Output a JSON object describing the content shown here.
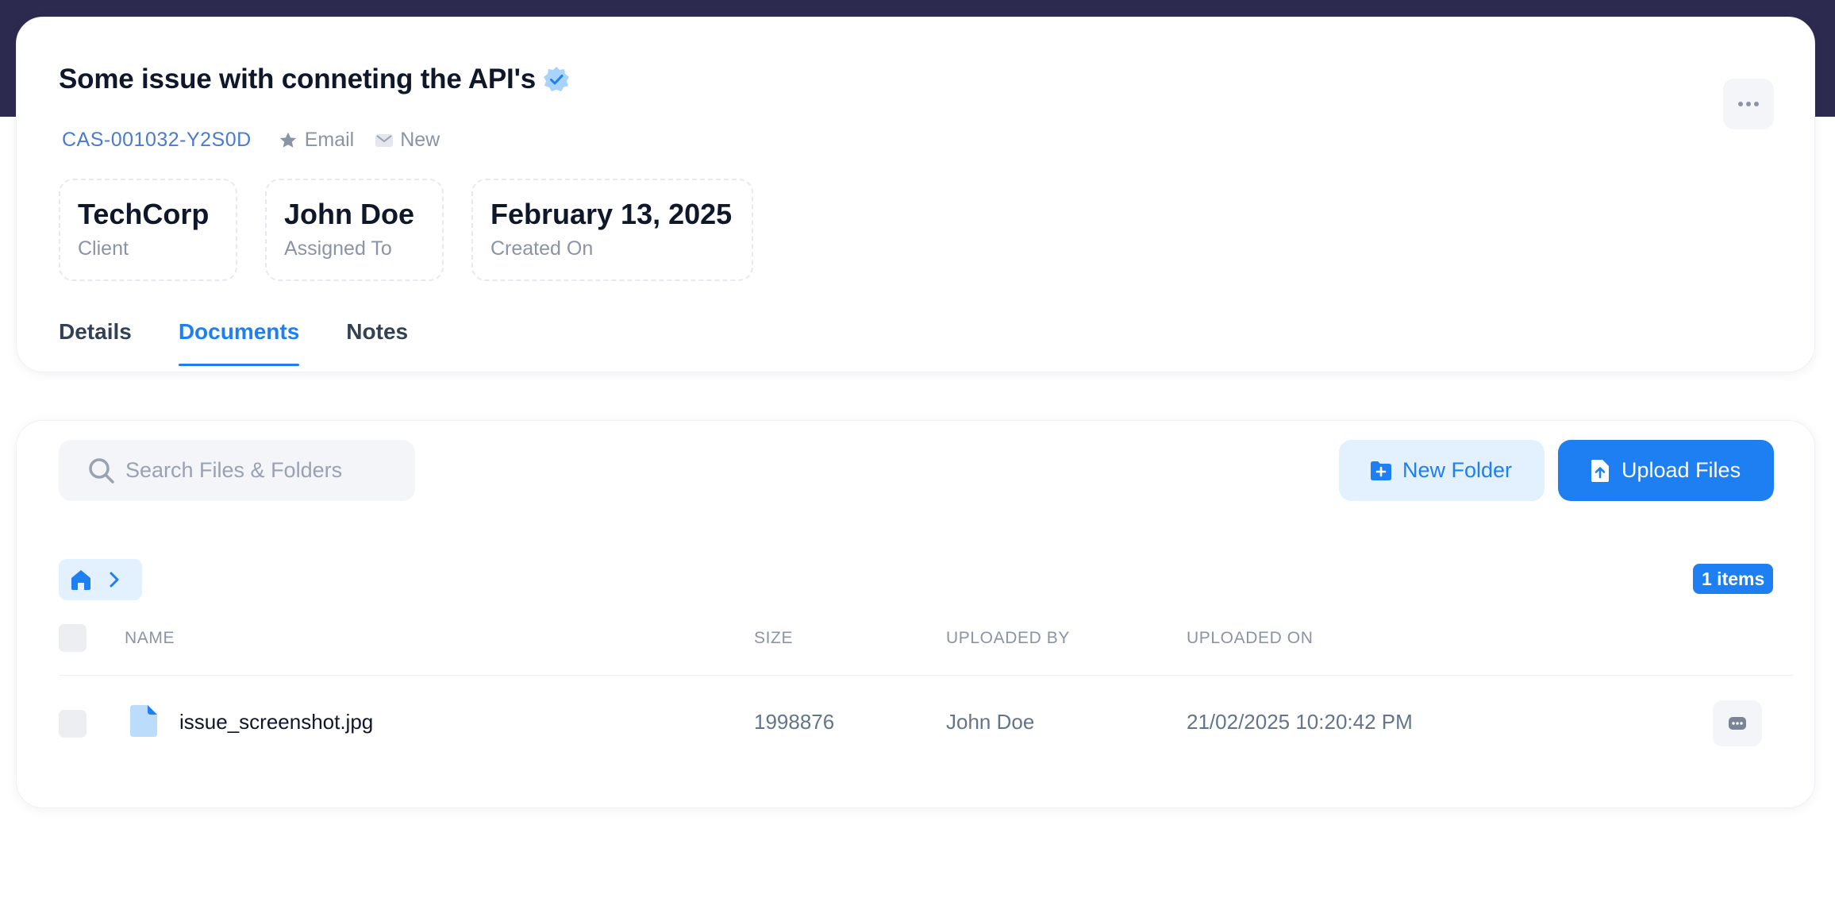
{
  "case": {
    "title": "Some issue with conneting the API's",
    "id": "CAS-001032-Y2S0D",
    "channel": "Email",
    "status": "New"
  },
  "stats": [
    {
      "value": "TechCorp",
      "label": "Client"
    },
    {
      "value": "John Doe",
      "label": "Assigned To"
    },
    {
      "value": "February 13, 2025",
      "label": "Created On"
    }
  ],
  "tabs": [
    {
      "label": "Details"
    },
    {
      "label": "Documents"
    },
    {
      "label": "Notes"
    }
  ],
  "active_tab": "Documents",
  "documents": {
    "search_placeholder": "Search Files & Folders",
    "new_folder_label": "New Folder",
    "upload_label": "Upload Files",
    "items_count": "1 items",
    "columns": {
      "name": "NAME",
      "size": "SIZE",
      "uploaded_by": "UPLOADED BY",
      "uploaded_on": "UPLOADED ON"
    },
    "rows": [
      {
        "name": "issue_screenshot.jpg",
        "size": "1998876",
        "uploaded_by": "John Doe",
        "uploaded_on": "21/02/2025 10:20:42 PM"
      }
    ]
  },
  "colors": {
    "accent": "#1d7ff2",
    "header_band": "#2c2a4f",
    "accent_soft": "#e3f0fd"
  },
  "icons": [
    "verified-badge-icon",
    "star-icon",
    "mail-icon",
    "more-horizontal-icon",
    "search-icon",
    "folder-plus-icon",
    "upload-icon",
    "home-icon",
    "chevron-right-icon",
    "file-icon"
  ]
}
